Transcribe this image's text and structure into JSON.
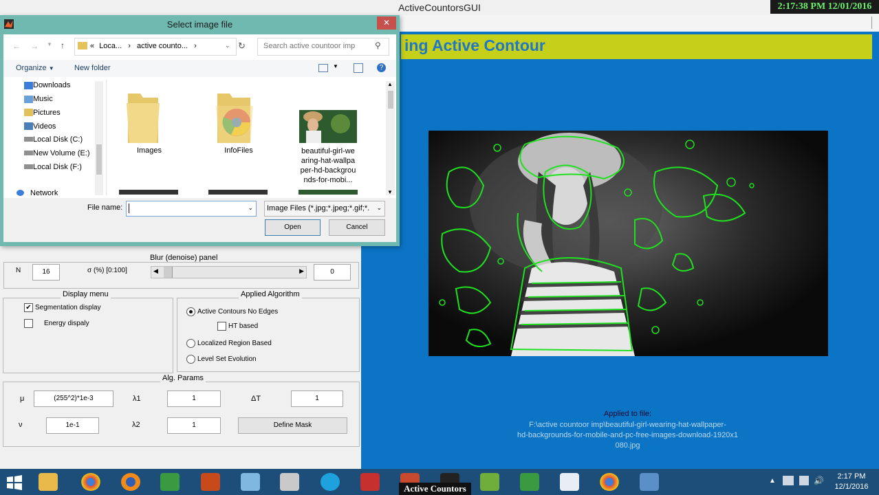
{
  "window": {
    "title": "ActiveCountorsGUI",
    "clock": "2:17:38 PM 12/01/2016"
  },
  "banner": {
    "title": "ing Active Contour"
  },
  "image_area": {
    "alt": "beautiful girl wearing hat segmented"
  },
  "applied": {
    "label": "Applied to file:",
    "file": "F:\\active countoor imp\\beautiful-girl-wearing-hat-wallpaper-hd-backgrounds-for-mobile-and-pc-free-images-download-1920x1080.jpg",
    "line1": "F:\\active countoor imp\\beautiful-girl-wearing-hat-wallpaper-",
    "line2": "hd-backgrounds-for-mobile-and-pc-free-images-download-1920x1",
    "line3": "080.jpg"
  },
  "blur_panel": {
    "title": "Blur (denoise) panel",
    "n_label": "N",
    "n_value": "16",
    "sigma_label": "σ (%) [0:100]",
    "sigma_value": "0",
    "slider_level": 0.0
  },
  "display_menu": {
    "title": "Display menu",
    "seg_label": "Segmentation display",
    "energy_label": "Energy dispaly",
    "seg_checked": "✔"
  },
  "algorithm": {
    "title": "Applied Algorithm",
    "options": [
      "Active Contours No Edges",
      "HT based",
      "Localized Region Based",
      "Level Set Evolution"
    ],
    "selected": "Active Contours No Edges"
  },
  "params": {
    "title": "Alg. Params",
    "mu_label": "μ",
    "mu_value": "(255^2)*1e-3",
    "lambda1_label": "λ1",
    "lambda1_value": "1",
    "dt_label": "ΔT",
    "dt_value": "1",
    "nu_label": "ν",
    "nu_value": "1e-1",
    "lambda2_label": "λ2",
    "lambda2_value": "1",
    "mask_button": "Define Mask"
  },
  "dialog": {
    "title": "Select image file",
    "close": "✕",
    "breadcrumb": [
      "«",
      "Loca...",
      "›",
      "active countо...",
      "›"
    ],
    "crumb_a": "Loca...",
    "crumb_b": "active counto...",
    "search_placeholder": "Search active countoor imp",
    "organize": "Organize",
    "new_folder": "New folder",
    "nav_items": [
      "Downloads",
      "Music",
      "Pictures",
      "Videos",
      "Local Disk (C:)",
      "New Volume (E:)",
      "Local Disk (F:)",
      "Network"
    ],
    "files": [
      {
        "name": "Images"
      },
      {
        "name": "InfoFiles"
      },
      {
        "name": "beautiful-girl-wearing-hat-wallpaper-hd-backgrounds-for-mobi..."
      }
    ],
    "file3_lines": [
      "beautiful-girl-we",
      "aring-hat-wallpa",
      "per-hd-backgrou",
      "nds-for-mobi..."
    ],
    "file_name_label": "File name:",
    "file_name_value": "",
    "filter": "Image Files (*.jpg;*.jpeg;*.gif;*.I",
    "open": "Open",
    "cancel": "Cancel"
  },
  "taskbar": {
    "active_label": "Active Countors",
    "time": "2:17 PM",
    "date": "12/1/2016"
  }
}
